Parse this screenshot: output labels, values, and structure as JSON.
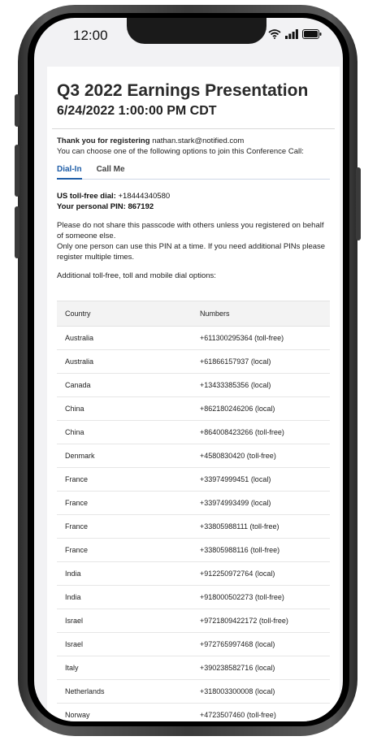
{
  "status": {
    "time": "12:00"
  },
  "event": {
    "title": "Q3 2022 Earnings Presentation",
    "datetime": "6/24/2022  1:00:00 PM CDT"
  },
  "registration": {
    "thanks_prefix": "Thank you for registering",
    "email": "nathan.stark@notified.com",
    "choose_text": "You can choose one of the following options to join this Conference Call:"
  },
  "tabs": [
    {
      "label": "Dial-In"
    },
    {
      "label": "Call Me"
    }
  ],
  "dial": {
    "tollfree_label": "US toll-free dial:",
    "tollfree_number": "+18444340580",
    "pin_label": "Your personal PIN:",
    "pin": "867192"
  },
  "notices": {
    "p1": "Please do not share this passcode with others unless you registered on behalf of someone else.",
    "p2": "Only one person can use this PIN at a time. If you need additional PINs please register multiple times.",
    "p3": "Additional toll-free, toll and mobile dial options:"
  },
  "table": {
    "headers": [
      "Country",
      "Numbers"
    ],
    "rows": [
      [
        "Australia",
        "+611300295364 (toll-free)"
      ],
      [
        "Australia",
        "+61866157937 (local)"
      ],
      [
        "Canada",
        "+13433385356 (local)"
      ],
      [
        "China",
        "+862180246206 (local)"
      ],
      [
        "China",
        "+864008423266 (toll-free)"
      ],
      [
        "Denmark",
        "+4580830420 (toll-free)"
      ],
      [
        "France",
        "+33974999451 (local)"
      ],
      [
        "France",
        "+33974993499 (local)"
      ],
      [
        "France",
        "+33805988111 (toll-free)"
      ],
      [
        "France",
        "+33805988116 (toll-free)"
      ],
      [
        "India",
        "+912250972764 (local)"
      ],
      [
        "India",
        "+918000502273 (toll-free)"
      ],
      [
        "Israel",
        "+9721809422172 (toll-free)"
      ],
      [
        "Israel",
        "+972765997468 (local)"
      ],
      [
        "Italy",
        "+390238582716 (local)"
      ],
      [
        "Netherlands",
        "+318003300008 (local)"
      ],
      [
        "Norway",
        "+4723507460 (toll-free)"
      ]
    ]
  }
}
